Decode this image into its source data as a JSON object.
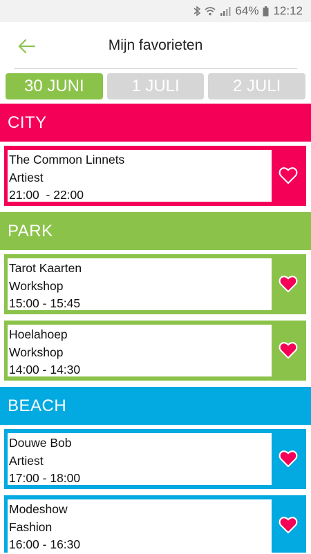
{
  "status_bar": {
    "battery": "64%",
    "time": "12:12",
    "icons": [
      "bluetooth-icon",
      "wifi-icon",
      "signal-icon",
      "battery-icon"
    ]
  },
  "header": {
    "title": "Mijn favorieten",
    "back_icon": "arrow-left-icon",
    "accent": "#8bc34a"
  },
  "tabs": [
    {
      "label": "30 JUNI",
      "active": true
    },
    {
      "label": "1 JULI",
      "active": false
    },
    {
      "label": "2 JULI",
      "active": false
    }
  ],
  "colors": {
    "city": "#f50057",
    "park": "#8bc34a",
    "beach": "#03a9e1",
    "tab_inactive": "#d6d6d6"
  },
  "sections": [
    {
      "name": "CITY",
      "items": [
        {
          "title": "The Common Linnets",
          "type": "Artiest",
          "time": "21:00  - 22:00",
          "favorite_icon": "heart-outline-icon"
        }
      ]
    },
    {
      "name": "PARK",
      "items": [
        {
          "title": "Tarot Kaarten",
          "type": "Workshop",
          "time": "15:00 - 15:45",
          "favorite_icon": "heart-filled-icon"
        },
        {
          "title": "Hoelahoep",
          "type": "Workshop",
          "time": "14:00 - 14:30",
          "favorite_icon": "heart-filled-icon"
        }
      ]
    },
    {
      "name": "BEACH",
      "items": [
        {
          "title": "Douwe Bob",
          "type": "Artiest",
          "time": "17:00 - 18:00",
          "favorite_icon": "heart-filled-icon"
        },
        {
          "title": "Modeshow",
          "type": "Fashion",
          "time": "16:00 - 16:30",
          "favorite_icon": "heart-filled-icon"
        }
      ]
    }
  ]
}
